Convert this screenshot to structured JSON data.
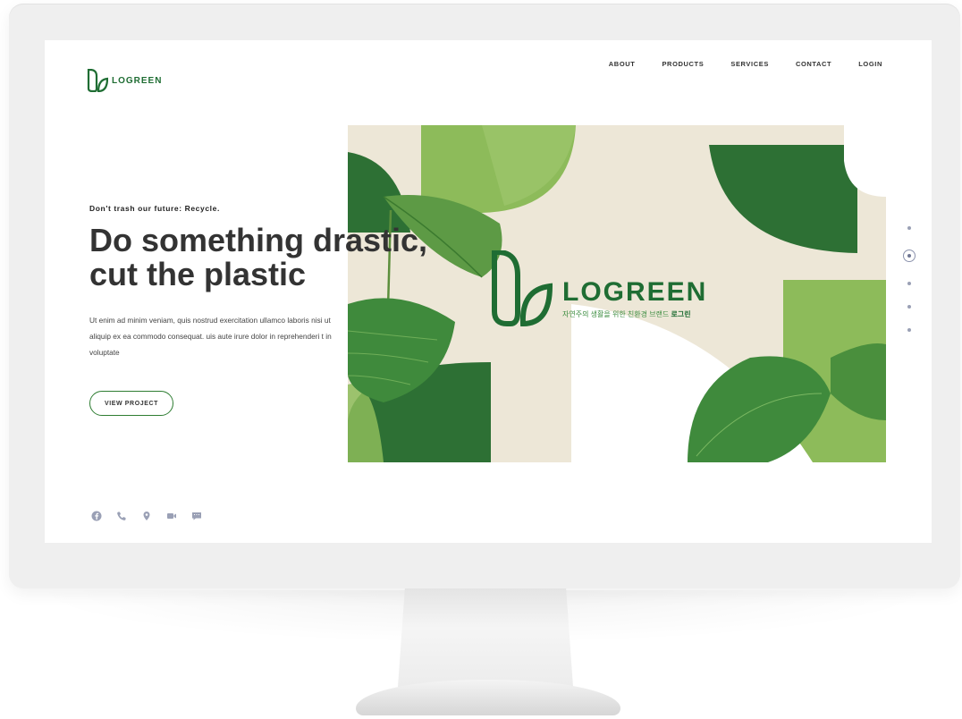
{
  "header": {
    "brand": "LOGREEN",
    "nav": [
      "ABOUT",
      "PRODUCTS",
      "SERVICES",
      "CONTACT",
      "LOGIN"
    ]
  },
  "hero": {
    "tagline": "Don't trash our future: Recycle.",
    "headline_line1": "Do something drastic,",
    "headline_line2": "cut the plastic",
    "body": "Ut enim ad minim veniam, quis nostrud exercitation ullamco laboris nisi ut aliquip ex ea commodo consequat. uis aute irure dolor in reprehenderi t in voluptate",
    "cta": "VIEW PROJECT"
  },
  "image": {
    "brand_title": "LOGREEN",
    "brand_sub_prefix": "자연주의 생활을 위한 친환경 브랜드",
    "brand_sub_bold": "로그린"
  },
  "socials": [
    "facebook-icon",
    "phone-icon",
    "location-icon",
    "video-icon",
    "chat-icon"
  ],
  "pager": {
    "count": 5,
    "active_index": 1
  },
  "colors": {
    "brand_green": "#1f6d33",
    "light_green": "#8dbb5a",
    "mid_green": "#3f8a3c",
    "beige": "#ede7d7",
    "icon_grey": "#9aa0b5"
  }
}
